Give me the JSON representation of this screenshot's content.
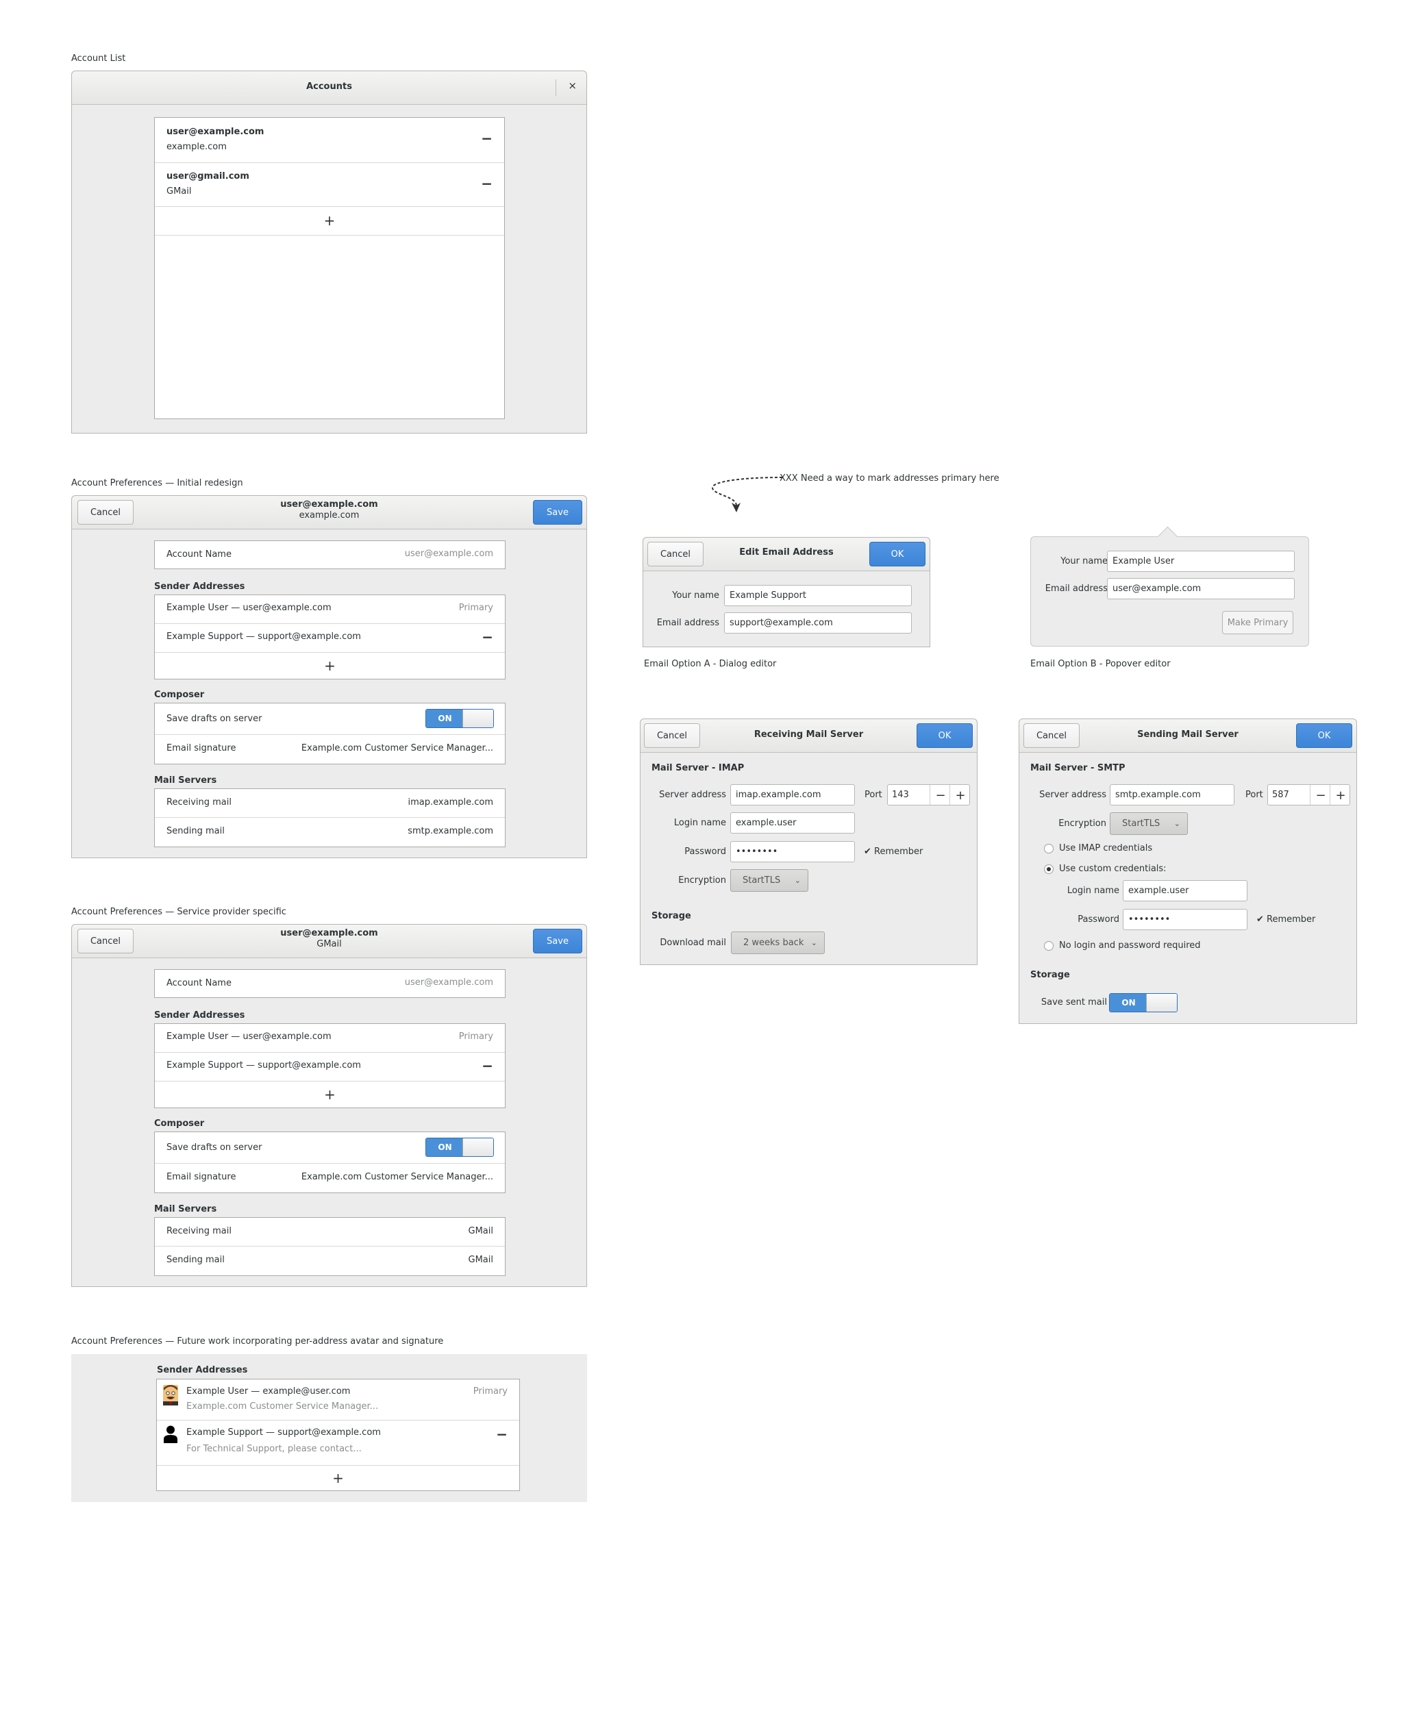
{
  "captions": {
    "account_list": "Account List",
    "initial": "Account Preferences — Initial redesign",
    "provider": "Account Preferences — Service provider specific",
    "future": "Account Preferences — Future work incorporating per-address avatar and signature",
    "option_a": "Email Option A - Dialog editor",
    "option_b": "Email Option B - Popover editor",
    "note": "XXX Need a way to mark addresses primary here"
  },
  "accounts": {
    "title": "Accounts",
    "close": "×",
    "items": [
      {
        "email": "user@example.com",
        "provider": "example.com"
      },
      {
        "email": "user@gmail.com",
        "provider": "GMail"
      }
    ],
    "add": "+",
    "remove": "−"
  },
  "common": {
    "cancel": "Cancel",
    "save": "Save",
    "ok": "OK",
    "minus": "−",
    "plus": "+"
  },
  "prefs_initial": {
    "title": "user@example.com",
    "subtitle": "example.com",
    "account_name_label": "Account Name",
    "account_name_placeholder": "user@example.com",
    "sender_heading": "Sender Addresses",
    "senders": [
      {
        "text": "Example User — user@example.com",
        "tag": "Primary"
      },
      {
        "text": "Example Support — support@example.com"
      }
    ],
    "composer_heading": "Composer",
    "save_drafts": "Save drafts on server",
    "switch_on": "ON",
    "signature_label": "Email signature",
    "signature_value": "Example.com Customer Service Manager...",
    "servers_heading": "Mail Servers",
    "receiving_label": "Receiving mail",
    "receiving_value": "imap.example.com",
    "sending_label": "Sending mail",
    "sending_value": "smtp.example.com"
  },
  "prefs_provider": {
    "title": "user@example.com",
    "subtitle": "GMail",
    "account_name_label": "Account Name",
    "account_name_placeholder": "user@example.com",
    "sender_heading": "Sender Addresses",
    "senders": [
      {
        "text": "Example User — user@example.com",
        "tag": "Primary"
      },
      {
        "text": "Example Support — support@example.com"
      }
    ],
    "composer_heading": "Composer",
    "save_drafts": "Save drafts on server",
    "switch_on": "ON",
    "signature_label": "Email signature",
    "signature_value": "Example.com Customer Service Manager...",
    "servers_heading": "Mail Servers",
    "receiving_label": "Receiving mail",
    "receiving_value": "GMail",
    "sending_label": "Sending mail",
    "sending_value": "GMail"
  },
  "future": {
    "heading": "Sender Addresses",
    "senders": [
      {
        "text": "Example User — example@user.com",
        "sub": "Example.com Customer Service Manager...",
        "tag": "Primary",
        "avatar": "user-photo-icon"
      },
      {
        "text": "Example Support — support@example.com",
        "sub": "For Technical Support, please contact...",
        "avatar": "person-silhouette-icon"
      }
    ]
  },
  "edit_dialog": {
    "title": "Edit Email Address",
    "name_label": "Your name",
    "name_value": "Example Support",
    "email_label": "Email address",
    "email_value": "support@example.com"
  },
  "popover": {
    "name_label": "Your name",
    "name_value": "Example User",
    "email_label": "Email address",
    "email_value": "user@example.com",
    "make_primary": "Make Primary"
  },
  "receiving": {
    "title": "Receiving Mail Server",
    "section": "Mail Server - IMAP",
    "server_label": "Server address",
    "server_value": "imap.example.com",
    "port_label": "Port",
    "port_value": "143",
    "login_label": "Login name",
    "login_value": "example.user",
    "password_label": "Password",
    "password_value": "••••••••",
    "remember": "✔ Remember",
    "encryption_label": "Encryption",
    "encryption_value": "StartTLS",
    "storage_heading": "Storage",
    "download_label": "Download mail",
    "download_value": "2 weeks back"
  },
  "sending": {
    "title": "Sending Mail Server",
    "section": "Mail Server - SMTP",
    "server_label": "Server address",
    "server_value": "smtp.example.com",
    "port_label": "Port",
    "port_value": "587",
    "encryption_label": "Encryption",
    "encryption_value": "StartTLS",
    "use_imap": "Use IMAP credentials",
    "use_custom": "Use custom credentials:",
    "login_label": "Login name",
    "login_value": "example.user",
    "password_label": "Password",
    "password_value": "••••••••",
    "remember": "✔ Remember",
    "no_login": "No login and password required",
    "storage_heading": "Storage",
    "save_sent": "Save sent mail",
    "switch_on": "ON"
  }
}
